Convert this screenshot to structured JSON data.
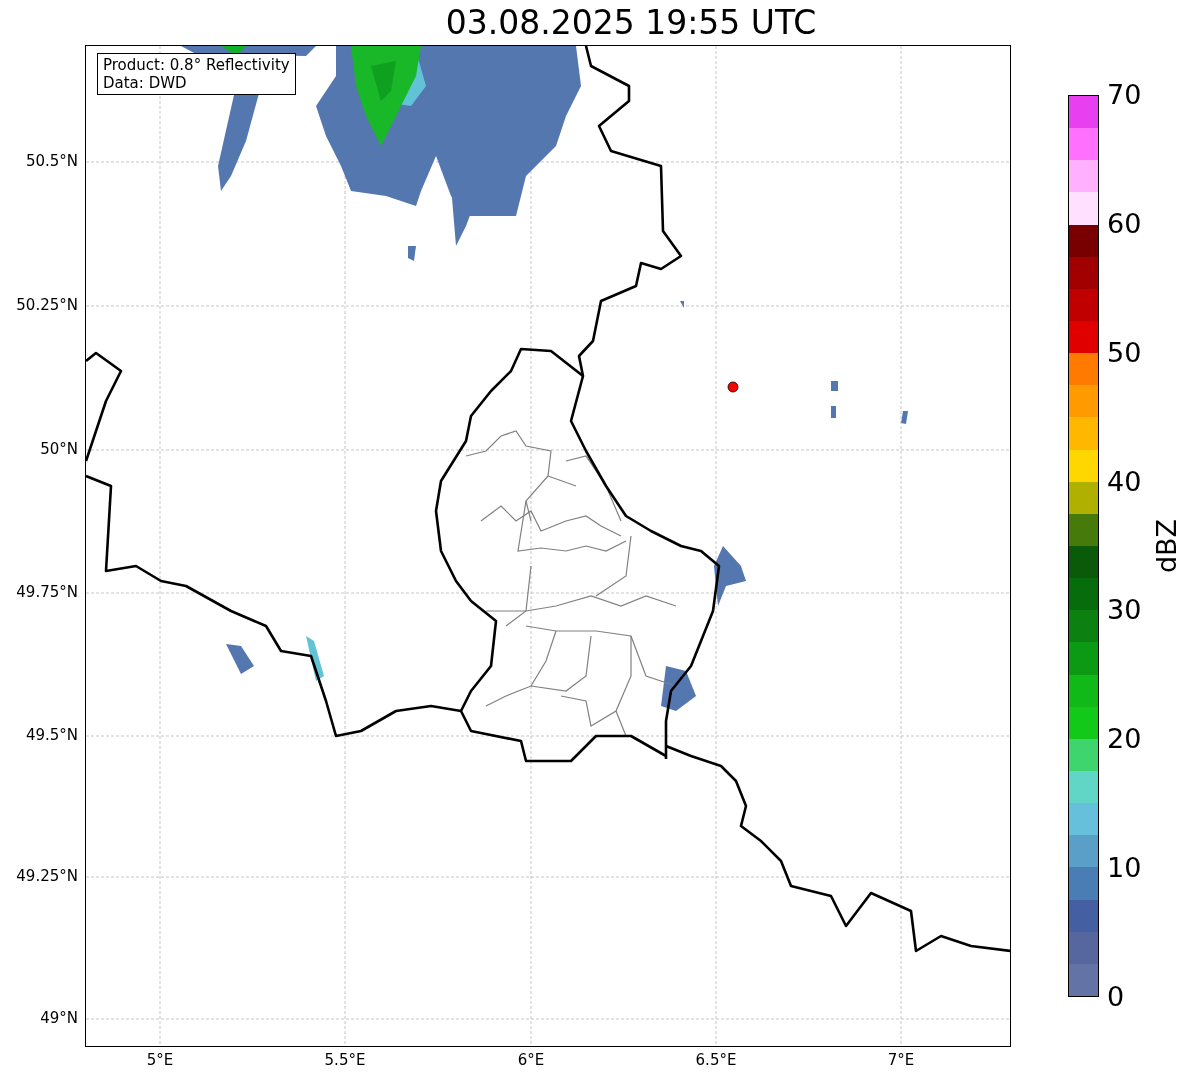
{
  "title": "03.08.2025 19:55 UTC",
  "map": {
    "info_box": [
      "Product: 0.8° Reflectivity",
      "Data: DWD"
    ],
    "yticks": [
      "50.5°N",
      "50.25°N",
      "50°N",
      "49.75°N",
      "49.5°N",
      "49.25°N",
      "49°N"
    ],
    "xticks": [
      "5°E",
      "5.5°E",
      "6°E",
      "6.5°E",
      "7°E"
    ]
  },
  "colorbar": {
    "label": "dBZ",
    "ticks": [
      "70",
      "60",
      "50",
      "40",
      "30",
      "20",
      "10",
      "0"
    ],
    "bins": [
      {
        "color": "#e840f0"
      },
      {
        "color": "#ff70ff"
      },
      {
        "color": "#ffb0ff"
      },
      {
        "color": "#ffe0ff"
      },
      {
        "color": "#780000"
      },
      {
        "color": "#a00000"
      },
      {
        "color": "#c00000"
      },
      {
        "color": "#e00000"
      },
      {
        "color": "#ff7a00"
      },
      {
        "color": "#ff9a00"
      },
      {
        "color": "#ffb700"
      },
      {
        "color": "#ffd700"
      },
      {
        "color": "#b0b000"
      },
      {
        "color": "#467a0a"
      },
      {
        "color": "#0a5a0a"
      },
      {
        "color": "#076c0c"
      },
      {
        "color": "#0c8010"
      },
      {
        "color": "#0c9a14"
      },
      {
        "color": "#10b818"
      },
      {
        "color": "#12c818"
      },
      {
        "color": "#3ed46e"
      },
      {
        "color": "#62d6c6"
      },
      {
        "color": "#66c0dc"
      },
      {
        "color": "#5a9fc8"
      },
      {
        "color": "#4a7db4"
      },
      {
        "color": "#4460a3"
      },
      {
        "color": "#56679f"
      },
      {
        "color": "#6473a6"
      }
    ]
  }
}
